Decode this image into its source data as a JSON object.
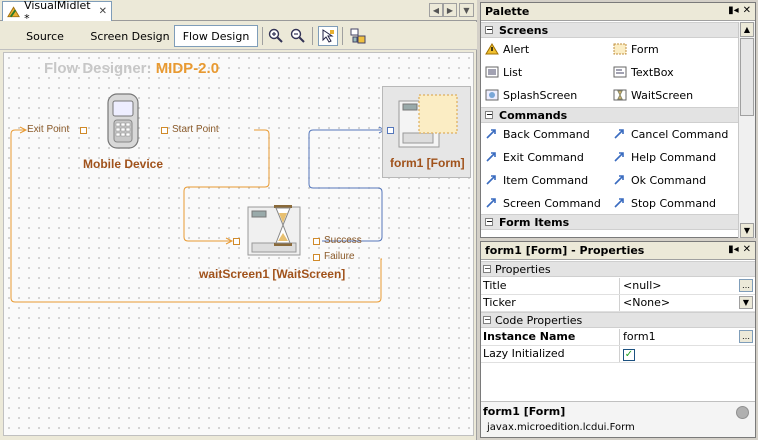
{
  "editor": {
    "tab_label": "VisualMidlet *",
    "close_glyph": "✕",
    "views": [
      "Source",
      "Screen Design",
      "Flow Design"
    ],
    "active_view": "Flow Design"
  },
  "flow": {
    "title_prefix": "Flow Designer:",
    "title_profile": "MIDP-2.0",
    "nodes": {
      "mobile_device": "Mobile Device",
      "form1": "form1 [Form]",
      "wait_screen": "waitScreen1 [WaitScreen]"
    },
    "pins": {
      "exit_point": "Exit Point",
      "start_point": "Start Point",
      "success": "Success",
      "failure": "Failure"
    },
    "colors": {
      "connector": "#e89a32",
      "connector_blue": "#5577bb",
      "title_accent": "#e89a32",
      "node_label": "#a0521b"
    }
  },
  "palette": {
    "title": "Palette",
    "categories": {
      "screens": "Screens",
      "commands": "Commands",
      "form_items": "Form Items"
    },
    "screens": [
      "Alert",
      "Form",
      "List",
      "TextBox",
      "SplashScreen",
      "WaitScreen"
    ],
    "commands": [
      "Back Command",
      "Cancel Command",
      "Exit Command",
      "Help Command",
      "Item Command",
      "Ok Command",
      "Screen Command",
      "Stop Command"
    ]
  },
  "properties": {
    "title": "form1 [Form] - Properties",
    "section_properties": "Properties",
    "title_key": "Title",
    "title_value": "<null>",
    "ticker_key": "Ticker",
    "ticker_value": "<None>",
    "section_code": "Code Properties",
    "instance_key": "Instance Name",
    "instance_value": "form1",
    "lazy_key": "Lazy Initialized",
    "lazy_checked": true,
    "footer_title": "form1 [Form]",
    "footer_class": "javax.microedition.lcdui.Form"
  }
}
